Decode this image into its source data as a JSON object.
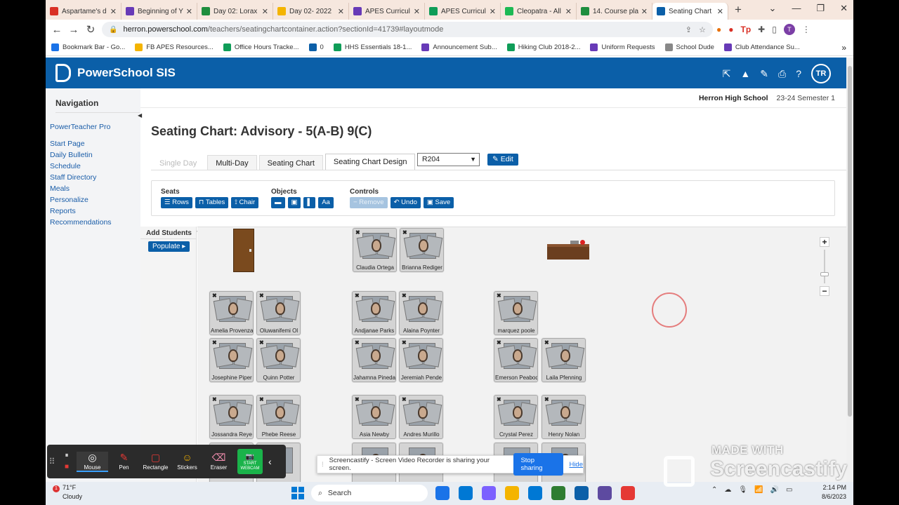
{
  "browser": {
    "tabs": [
      {
        "label": "Aspartame's d",
        "color": "#d93025"
      },
      {
        "label": "Beginning of Y",
        "color": "#673ab7"
      },
      {
        "label": "Day 02: Lorax",
        "color": "#1e8e3e"
      },
      {
        "label": "Day 02- 2022",
        "color": "#f4b400"
      },
      {
        "label": "APES Curricul",
        "color": "#673ab7"
      },
      {
        "label": "APES Curricul",
        "color": "#0f9d58"
      },
      {
        "label": "Cleopatra - All",
        "color": "#1db954"
      },
      {
        "label": "14. Course pla",
        "color": "#1e8e3e"
      },
      {
        "label": "Seating Chart",
        "color": "#0b5fa8"
      }
    ],
    "url_domain": "herron.powerschool.com",
    "url_path": "/teachers/seatingchartcontainer.action?sectionId=41739#layoutmode",
    "profile_initial": "T",
    "bookmarks": [
      {
        "label": "Bookmark Bar - Go...",
        "color": "#1a73e8"
      },
      {
        "label": "FB APES Resources...",
        "color": "#f4b400"
      },
      {
        "label": "Office Hours Tracke...",
        "color": "#0f9d58"
      },
      {
        "label": "0",
        "color": "#0b5fa8"
      },
      {
        "label": "HHS Essentials 18-1...",
        "color": "#0f9d58"
      },
      {
        "label": "Announcement Sub...",
        "color": "#673ab7"
      },
      {
        "label": "Hiking Club 2018-2...",
        "color": "#0f9d58"
      },
      {
        "label": "Uniform Requests",
        "color": "#673ab7"
      },
      {
        "label": "School Dude",
        "color": "#888888"
      },
      {
        "label": "Club Attendance Su...",
        "color": "#673ab7"
      }
    ]
  },
  "app": {
    "name": "PowerSchool SIS",
    "user_initials": "TR",
    "school": "Herron High School",
    "term": "23-24 Semester 1"
  },
  "nav": {
    "heading": "Navigation",
    "app_link": "PowerTeacher Pro",
    "links": [
      "Start Page",
      "Daily Bulletin",
      "Schedule",
      "Staff Directory",
      "Meals",
      "Personalize",
      "Reports",
      "Recommendations"
    ]
  },
  "page": {
    "title": "Seating Chart: Advisory - 5(A-B) 9(C)",
    "tabs": [
      "Single Day",
      "Multi-Day",
      "Seating Chart",
      "Seating Chart Design"
    ],
    "active_tab": "Seating Chart Design",
    "room": "R204",
    "edit_label": "Edit"
  },
  "toolbar": {
    "seats_label": "Seats",
    "seats_buttons": [
      "Rows",
      "Tables",
      "Chair"
    ],
    "objects_label": "Objects",
    "objects_buttons": [
      "▬",
      "▣",
      "▌",
      "Aa"
    ],
    "controls_label": "Controls",
    "controls_buttons": [
      "Remove",
      "Undo",
      "Save"
    ]
  },
  "add_students": {
    "heading": "Add Students",
    "populate_label": "Populate"
  },
  "seats": [
    "Claudia Ortega",
    "Brianna Rediger",
    "Amelia Provenza",
    "Oluwanifemi Ol",
    "Andjanae Parks",
    "Alaina Poynter",
    "marquez poole",
    "Josephine Piper",
    "Quinn Potter",
    "Jahamna Pineda",
    "Jeremiah Pende",
    "Emerson Peabody",
    "Laila Pfenning",
    "Jossandra Reye",
    "Phebe Reese",
    "Asia Newby",
    "Andres Murillo",
    "Crystal Perez",
    "Henry Nolan"
  ],
  "recorder": {
    "tools": [
      "Mouse",
      "Pen",
      "Rectangle",
      "Stickers",
      "Eraser"
    ],
    "webcam_label": "START WEBCAM",
    "share_text": "Screencastify - Screen Video Recorder is sharing your screen.",
    "stop_label": "Stop sharing",
    "hide_label": "Hide",
    "watermark_top": "MADE WITH",
    "watermark_brand": "Screencastify"
  },
  "taskbar": {
    "temp": "71°F",
    "weather": "Cloudy",
    "search_label": "Search",
    "time": "2:14 PM",
    "date": "8/6/2023",
    "app_colors": [
      "#1a73e8",
      "#0078d4",
      "#7b61ff",
      "#f4b400",
      "#0078d4",
      "#2e7d32",
      "#0b5fa8",
      "#5d4aa0",
      "#e53935"
    ]
  }
}
